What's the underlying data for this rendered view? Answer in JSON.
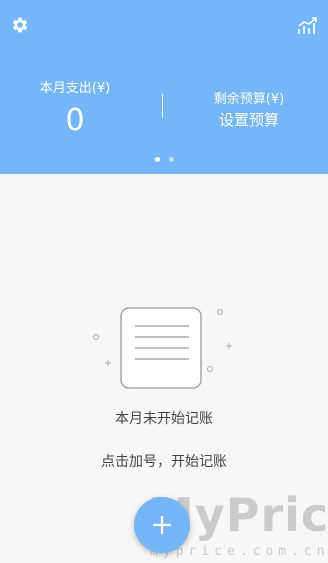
{
  "header": {
    "spent_label": "本月支出(¥)",
    "spent_value": "0",
    "budget_label": "剩余预算(¥)",
    "budget_action": "设置预算",
    "page_count": 2,
    "active_page": 1
  },
  "empty_state": {
    "title": "本月未开始记账",
    "hint": "点击加号，开始记账"
  },
  "fab": {
    "icon": "plus-icon"
  },
  "watermark": {
    "brand": "MyPrice",
    "url": "myprice.com.cn"
  },
  "colors": {
    "accent": "#74b6f6",
    "background": "#f7f7f7",
    "text": "#444444"
  }
}
